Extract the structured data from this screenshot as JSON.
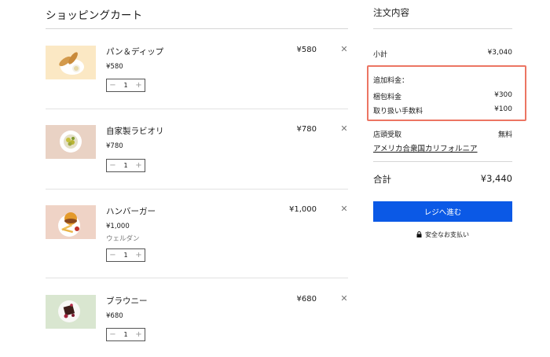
{
  "cart": {
    "title": "ショッピングカート",
    "items": [
      {
        "name": "パン＆ディップ",
        "price": "¥580",
        "unit_price": "¥580",
        "qty": "1",
        "variant": "",
        "image": "bread-and-dip-photo",
        "thumb_bg": "#fbe8c4"
      },
      {
        "name": "自家製ラビオリ",
        "price": "¥780",
        "unit_price": "¥780",
        "qty": "1",
        "variant": "",
        "image": "ravioli-photo",
        "thumb_bg": "#e9d2c4"
      },
      {
        "name": "ハンバーガー",
        "price": "¥1,000",
        "unit_price": "¥1,000",
        "qty": "1",
        "variant": "ウェルダン",
        "image": "hamburger-photo",
        "thumb_bg": "#efd3c6"
      },
      {
        "name": "ブラウニー",
        "price": "¥680",
        "unit_price": "¥680",
        "qty": "1",
        "variant": "",
        "image": "brownie-photo",
        "thumb_bg": "#d9e6d0"
      }
    ],
    "qty_minus": "−",
    "qty_plus": "+",
    "remove_icon": "close-icon"
  },
  "summary": {
    "title": "注文内容",
    "subtotal_label": "小計",
    "subtotal_value": "¥3,040",
    "additional_label": "追加料金：",
    "packaging_label": "梱包料金",
    "packaging_value": "¥300",
    "handling_label": "取り扱い手数料",
    "handling_value": "¥100",
    "pickup_label": "店頭受取",
    "pickup_value": "無料",
    "pickup_location": "アメリカ合衆国カリフォルニア",
    "total_label": "合計",
    "total_value": "¥3,440",
    "checkout_label": "レジへ進む",
    "secure_label": "安全なお支払い"
  },
  "colors": {
    "accent": "#0b59e6",
    "highlight_border": "#ec7563"
  }
}
